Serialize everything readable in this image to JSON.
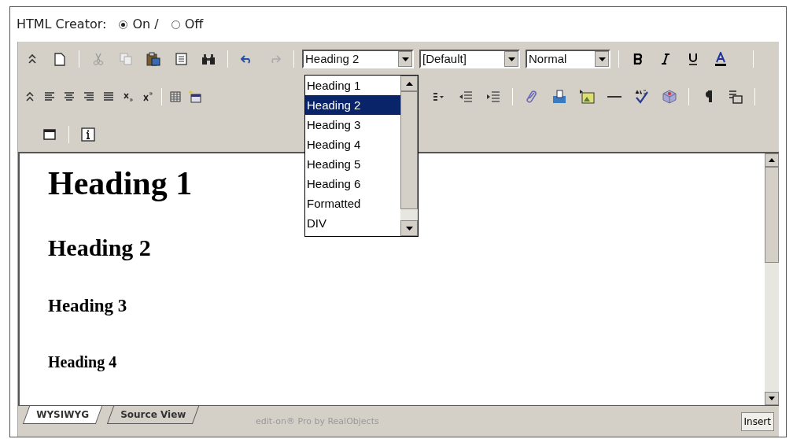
{
  "header": {
    "label": "HTML Creator:",
    "options": [
      {
        "label": "On /",
        "selected": true
      },
      {
        "label": "Off",
        "selected": false
      }
    ]
  },
  "toolbar": {
    "block_format": "Heading 2",
    "font": "[Default]",
    "size": "Normal"
  },
  "format_dropdown": {
    "items": [
      {
        "label": "Heading 1",
        "selected": false
      },
      {
        "label": "Heading 2",
        "selected": true
      },
      {
        "label": "Heading 3",
        "selected": false
      },
      {
        "label": "Heading 4",
        "selected": false
      },
      {
        "label": "Heading 5",
        "selected": false
      },
      {
        "label": "Heading 6",
        "selected": false
      },
      {
        "label": "Formatted",
        "selected": false
      },
      {
        "label": "DIV",
        "selected": false
      }
    ]
  },
  "document": {
    "headings": [
      {
        "kind": "h1",
        "text": "Heading 1"
      },
      {
        "kind": "h2",
        "text": "Heading 2"
      },
      {
        "kind": "h3",
        "text": "Heading 3"
      },
      {
        "kind": "h4",
        "text": "Heading 4"
      }
    ]
  },
  "tabs": [
    {
      "label": "WYSIWYG",
      "selected": true
    },
    {
      "label": "Source View",
      "selected": false
    }
  ],
  "footer_credit": "edit-on® Pro by RealObjects",
  "mode": "Insert"
}
